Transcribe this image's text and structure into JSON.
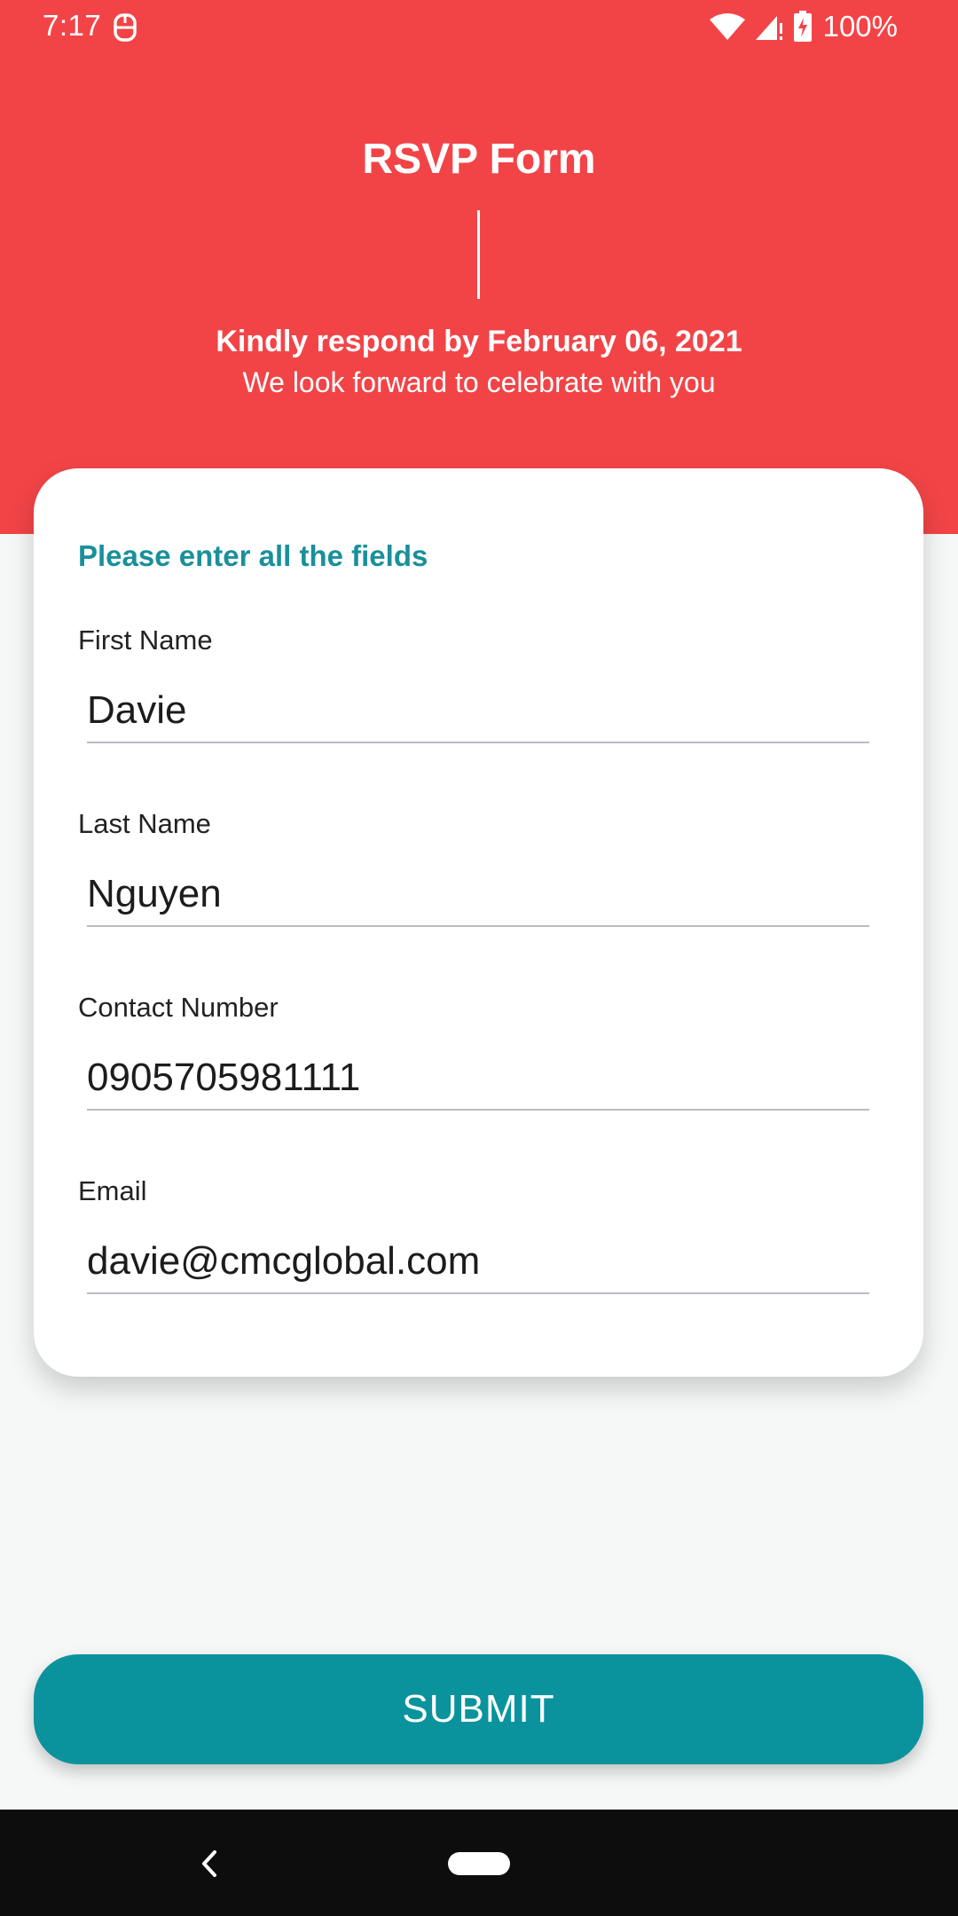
{
  "status_bar": {
    "time": "7:17",
    "battery": "100%",
    "icons": [
      "notification-icon",
      "wifi-icon",
      "cell-signal-icon",
      "battery-charging-icon"
    ]
  },
  "header": {
    "title": "RSVP Form",
    "respond_by": "Kindly respond by February 06, 2021",
    "subtitle": "We look forward to celebrate with you"
  },
  "form": {
    "heading": "Please enter all the fields",
    "first_name": {
      "label": "First Name",
      "value": "Davie"
    },
    "last_name": {
      "label": "Last Name",
      "value": "Nguyen"
    },
    "contact": {
      "label": "Contact Number",
      "value": "0905705981111"
    },
    "email": {
      "label": "Email",
      "value": "davie@cmcglobal.com"
    }
  },
  "submit_label": "SUBMIT",
  "colors": {
    "header_bg": "#f24447",
    "accent": "#0b939d",
    "heading_text": "#19909a"
  },
  "nav_bar": {
    "icons": [
      "back-icon",
      "home-icon"
    ]
  }
}
